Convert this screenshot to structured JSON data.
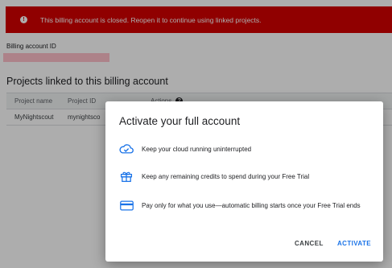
{
  "banner": {
    "message": "This billing account is closed. Reopen it to continue using linked projects.",
    "icon": "alert-icon",
    "color": "#d50000"
  },
  "account": {
    "id_label": "Billing account ID",
    "id_value": ""
  },
  "projects": {
    "heading": "Projects linked to this billing account",
    "columns": [
      "Project name",
      "Project ID",
      "Actions"
    ],
    "rows": [
      {
        "name": "MyNightscout",
        "id": "mynightsco"
      }
    ]
  },
  "dialog": {
    "title": "Activate your full account",
    "features": [
      {
        "icon": "cloud-check-icon",
        "text": "Keep your cloud running uninterrupted"
      },
      {
        "icon": "gift-icon",
        "text": "Keep any remaining credits to spend during your Free Trial"
      },
      {
        "icon": "credit-card-icon",
        "text": "Pay only for what you use—automatic billing starts once your Free Trial ends"
      }
    ],
    "cancel_label": "CANCEL",
    "activate_label": "ACTIVATE",
    "accent_color": "#1a73e8"
  }
}
